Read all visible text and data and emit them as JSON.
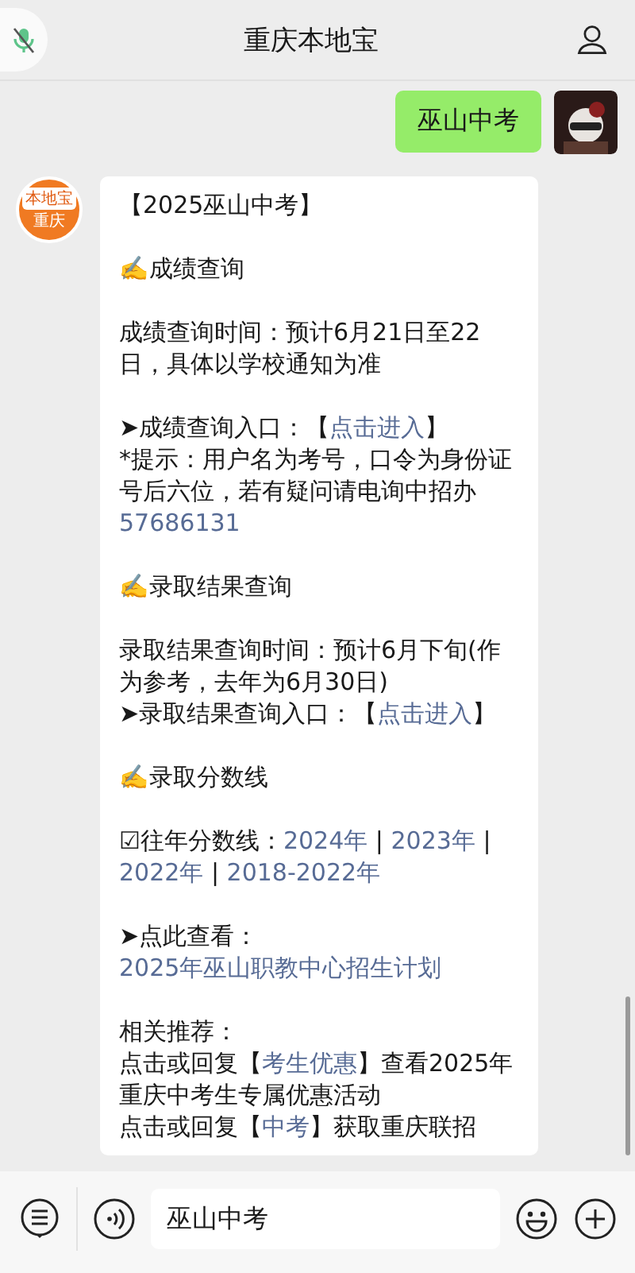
{
  "header": {
    "title": "重庆本地宝"
  },
  "outgoing": {
    "text": "巫山中考"
  },
  "incoming": {
    "avatar_top": "本地宝",
    "avatar_bottom": "重庆",
    "paragraphs": [
      {
        "lines": [
          [
            {
              "kind": "text",
              "text": "【2025巫山中考】"
            }
          ]
        ]
      },
      {
        "lines": [
          [
            {
              "kind": "text",
              "text": "✍️成绩查询"
            }
          ]
        ]
      },
      {
        "lines": [
          [
            {
              "kind": "text",
              "text": "成绩查询时间：预计6月21日至22日，具体以学校通知为准"
            }
          ]
        ]
      },
      {
        "lines": [
          [
            {
              "kind": "text",
              "text": "➤成绩查询入口：【"
            },
            {
              "kind": "link",
              "text": "点击进入"
            },
            {
              "kind": "text",
              "text": "】"
            }
          ],
          [
            {
              "kind": "text",
              "text": "*提示：用户名为考号，口令为身份证号后六位，若有疑问请电询中招办"
            },
            {
              "kind": "link",
              "text": "57686131"
            }
          ]
        ]
      },
      {
        "lines": [
          [
            {
              "kind": "text",
              "text": "✍️录取结果查询"
            }
          ]
        ]
      },
      {
        "lines": [
          [
            {
              "kind": "text",
              "text": "录取结果查询时间：预计6月下旬(作为参考，去年为6月30日)"
            }
          ],
          [
            {
              "kind": "text",
              "text": "➤录取结果查询入口：【"
            },
            {
              "kind": "link",
              "text": "点击进入"
            },
            {
              "kind": "text",
              "text": "】"
            }
          ]
        ]
      },
      {
        "lines": [
          [
            {
              "kind": "text",
              "text": "✍️录取分数线"
            }
          ]
        ]
      },
      {
        "lines": [
          [
            {
              "kind": "text",
              "text": "☑往年分数线："
            },
            {
              "kind": "link",
              "text": "2024年"
            },
            {
              "kind": "text",
              "text": " | "
            },
            {
              "kind": "link",
              "text": "2023年"
            },
            {
              "kind": "text",
              "text": " | "
            },
            {
              "kind": "link",
              "text": "2022年"
            },
            {
              "kind": "text",
              "text": " | "
            },
            {
              "kind": "link",
              "text": "2018-2022年"
            }
          ]
        ]
      },
      {
        "lines": [
          [
            {
              "kind": "text",
              "text": "➤点此查看："
            },
            {
              "kind": "link",
              "text": "2025年巫山职教中心招生计划"
            }
          ]
        ]
      },
      {
        "lines": [
          [
            {
              "kind": "text",
              "text": "相关推荐："
            }
          ],
          [
            {
              "kind": "text",
              "text": "点击或回复【"
            },
            {
              "kind": "link",
              "text": "考生优惠"
            },
            {
              "kind": "text",
              "text": "】查看2025年重庆中考生专属优惠活动"
            }
          ],
          [
            {
              "kind": "text",
              "text": "点击或回复【"
            },
            {
              "kind": "link",
              "text": "中考"
            },
            {
              "kind": "text",
              "text": "】获取重庆联招"
            }
          ]
        ]
      }
    ]
  },
  "input": {
    "value": "巫山中考"
  }
}
